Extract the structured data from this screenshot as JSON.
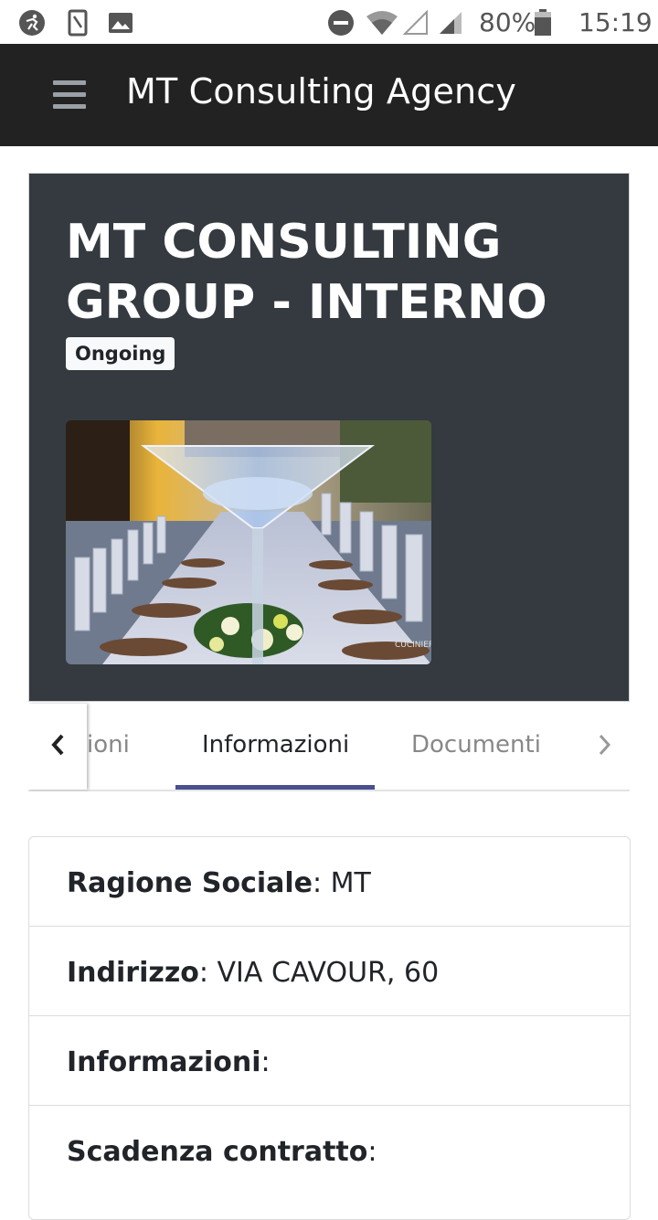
{
  "status_bar": {
    "left_icons": [
      "accessibility-icon",
      "phone-outline-icon",
      "image-icon"
    ],
    "right_icons": [
      "do-not-disturb-icon",
      "wifi-icon",
      "signal-empty-icon",
      "signal-icon",
      "battery-icon"
    ],
    "battery": "80%",
    "time": "15:19"
  },
  "app_bar": {
    "title": "MT Consulting Agency",
    "menu_icon": "hamburger-menu-icon"
  },
  "hero": {
    "title": "MT CONSULTING GROUP - INTERNO",
    "badge": "Ongoing"
  },
  "tabs": {
    "items": [
      {
        "label": "ioni",
        "active": false
      },
      {
        "label": "Informazioni",
        "active": true
      },
      {
        "label": "Documenti",
        "active": false
      }
    ],
    "prev_icon": "chevron-left-icon",
    "next_icon": "chevron-right-icon"
  },
  "info": {
    "rows": [
      {
        "label": "Ragione Sociale",
        "sep": ":",
        "value": " MT"
      },
      {
        "label": "Indirizzo",
        "sep": ":",
        "value": " VIA CAVOUR, 60"
      },
      {
        "label": "Informazioni",
        "sep": ":",
        "value": ""
      },
      {
        "label": "Scadenza contratto",
        "sep": ":",
        "value": ""
      }
    ]
  },
  "colors": {
    "app_bar_bg": "#222222",
    "hero_bg": "#343a40",
    "tab_indicator": "#4a4f8f",
    "tab_active_text": "#212529",
    "tab_inactive_text": "#888888"
  }
}
